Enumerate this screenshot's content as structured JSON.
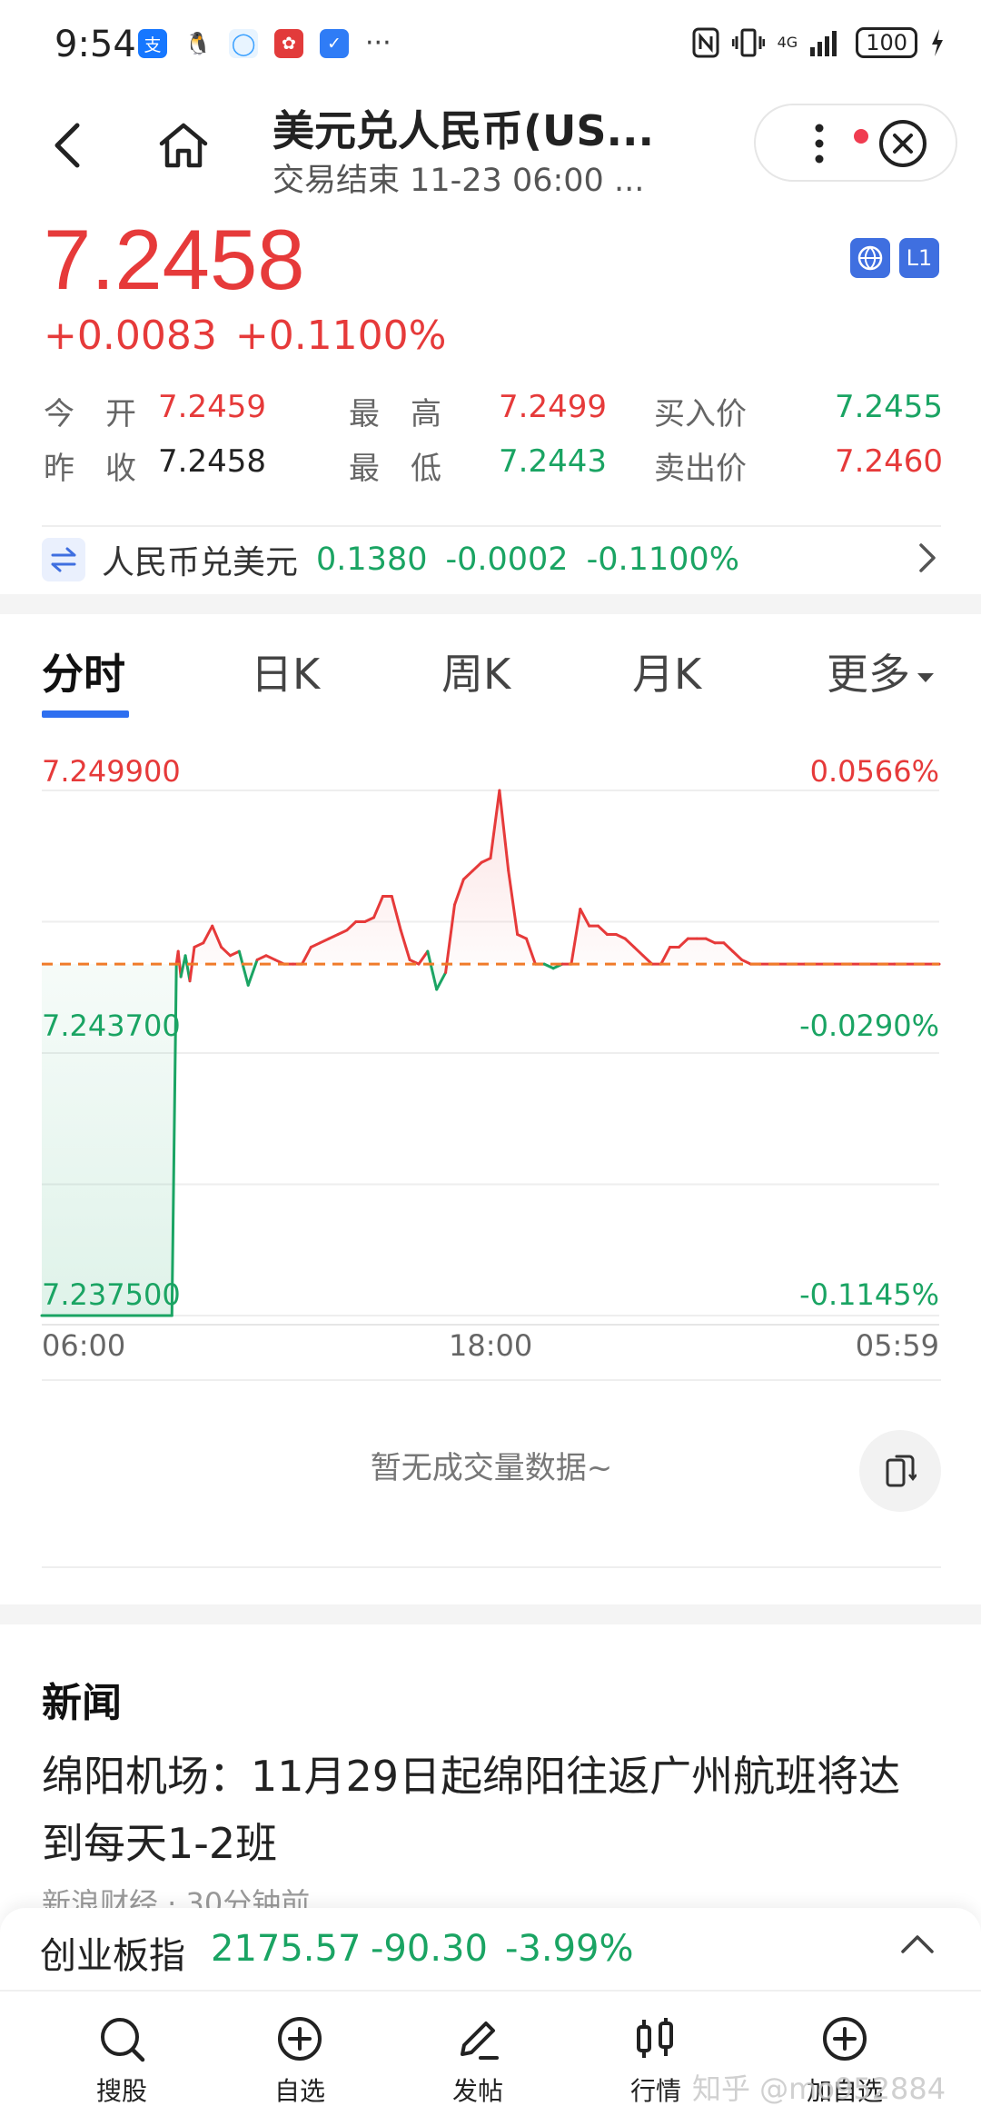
{
  "status_bar": {
    "time": "9:54",
    "apps": [
      {
        "name": "alipay",
        "glyph": "支",
        "color": "#1677ff"
      },
      {
        "name": "qq",
        "glyph": "🐧",
        "color": "#ffffff"
      },
      {
        "name": "browser",
        "glyph": "◯",
        "color": "#3aa0ff"
      },
      {
        "name": "huawei",
        "glyph": "✿",
        "color": "#e23b3b"
      },
      {
        "name": "shield",
        "glyph": "✓",
        "color": "#2f7cf6"
      }
    ],
    "more": "···",
    "network": "4G",
    "battery": "100"
  },
  "header": {
    "title": "美元兑人民币(US...",
    "subtitle": "交易结束 11-23 06:00 ..."
  },
  "quote": {
    "price": "7.2458",
    "change": "+0.0083",
    "change_pct": "+0.1100%",
    "badge_level": "L1",
    "rows": [
      {
        "l1": "今　开",
        "v1": "7.2459",
        "l2": "最　高",
        "v2": "7.2499",
        "l3": "买入价",
        "v3": "7.2455"
      },
      {
        "l1": "昨　收",
        "v1": "7.2458",
        "l2": "最　低",
        "v2": "7.2443",
        "l3": "卖出价",
        "v3": "7.2460"
      }
    ]
  },
  "cross_rate": {
    "label": "人民币兑美元",
    "value": "0.1380",
    "change": "-0.0002",
    "change_pct": "-0.1100%"
  },
  "tabs": [
    {
      "label": "分时"
    },
    {
      "label": "日K"
    },
    {
      "label": "周K"
    },
    {
      "label": "月K"
    },
    {
      "label": "更多"
    }
  ],
  "chart_data": {
    "type": "line",
    "price_ticks": [
      "7.249900",
      "7.243700",
      "7.237500"
    ],
    "pct_ticks": [
      "0.0566%",
      "-0.0290%",
      "-0.1145%"
    ],
    "time_ticks": [
      "06:00",
      "18:00",
      "05:59"
    ],
    "reference_price": 7.2458,
    "ylim": [
      7.2375,
      7.2499
    ],
    "xlim": [
      0,
      100
    ],
    "series": [
      {
        "x": [
          0,
          14.5,
          15.0,
          15.2,
          15.5,
          16,
          16.5,
          17,
          18,
          19,
          20,
          21,
          22,
          23,
          24,
          25,
          26,
          27,
          28,
          29,
          30,
          31,
          32,
          33,
          34,
          35,
          36,
          37,
          38,
          39,
          40,
          41,
          42,
          43,
          44,
          45,
          46,
          47,
          48,
          49,
          50,
          51,
          52,
          53,
          54,
          55,
          56,
          57,
          58,
          59,
          60,
          61,
          62,
          63,
          64,
          65,
          66,
          67,
          68,
          69,
          70,
          71,
          72,
          73,
          74,
          75,
          76,
          77,
          78,
          79,
          80,
          85,
          90,
          95,
          100
        ],
        "y": [
          7.2375,
          7.2375,
          7.2458,
          7.2461,
          7.2455,
          7.246,
          7.2454,
          7.2462,
          7.2463,
          7.2467,
          7.2462,
          7.246,
          7.2461,
          7.2453,
          7.2459,
          7.246,
          7.2459,
          7.2458,
          7.2458,
          7.2458,
          7.2462,
          7.2463,
          7.2464,
          7.2465,
          7.2466,
          7.2468,
          7.2468,
          7.2469,
          7.2474,
          7.2474,
          7.2466,
          7.2459,
          7.2458,
          7.2461,
          7.2452,
          7.2456,
          7.2472,
          7.2478,
          7.248,
          7.2482,
          7.2483,
          7.2499,
          7.248,
          7.2465,
          7.2464,
          7.2458,
          7.2458,
          7.2457,
          7.2458,
          7.2458,
          7.2471,
          7.2467,
          7.2467,
          7.2465,
          7.2465,
          7.2464,
          7.2462,
          7.246,
          7.2458,
          7.2458,
          7.2462,
          7.2462,
          7.2464,
          7.2464,
          7.2464,
          7.2463,
          7.2463,
          7.2461,
          7.2459,
          7.2458,
          7.2458,
          7.2458,
          7.2458,
          7.2458,
          7.2458
        ]
      }
    ]
  },
  "volume": {
    "empty_text": "暂无成交量数据~"
  },
  "news": {
    "title": "新闻",
    "headline": "绵阳机场：11月29日起绵阳往返广州航班将达到每天1-2班",
    "meta": "新浪财经 · 30分钟前"
  },
  "index_bar": {
    "name": "创业板指",
    "value": "2175.57",
    "change": "-90.30",
    "change_pct": "-3.99%"
  },
  "bottom_nav": [
    {
      "label": "搜股",
      "icon": "search-icon"
    },
    {
      "label": "自选",
      "icon": "add-circle-icon"
    },
    {
      "label": "发帖",
      "icon": "pen-icon"
    },
    {
      "label": "行情",
      "icon": "candlestick-icon"
    },
    {
      "label": "加自选",
      "icon": "add-circle-icon"
    }
  ],
  "watermark": "知乎 @mo952884",
  "colors": {
    "up": "#e63a3a",
    "down": "#1aa463",
    "accent": "#2e6ff0"
  }
}
